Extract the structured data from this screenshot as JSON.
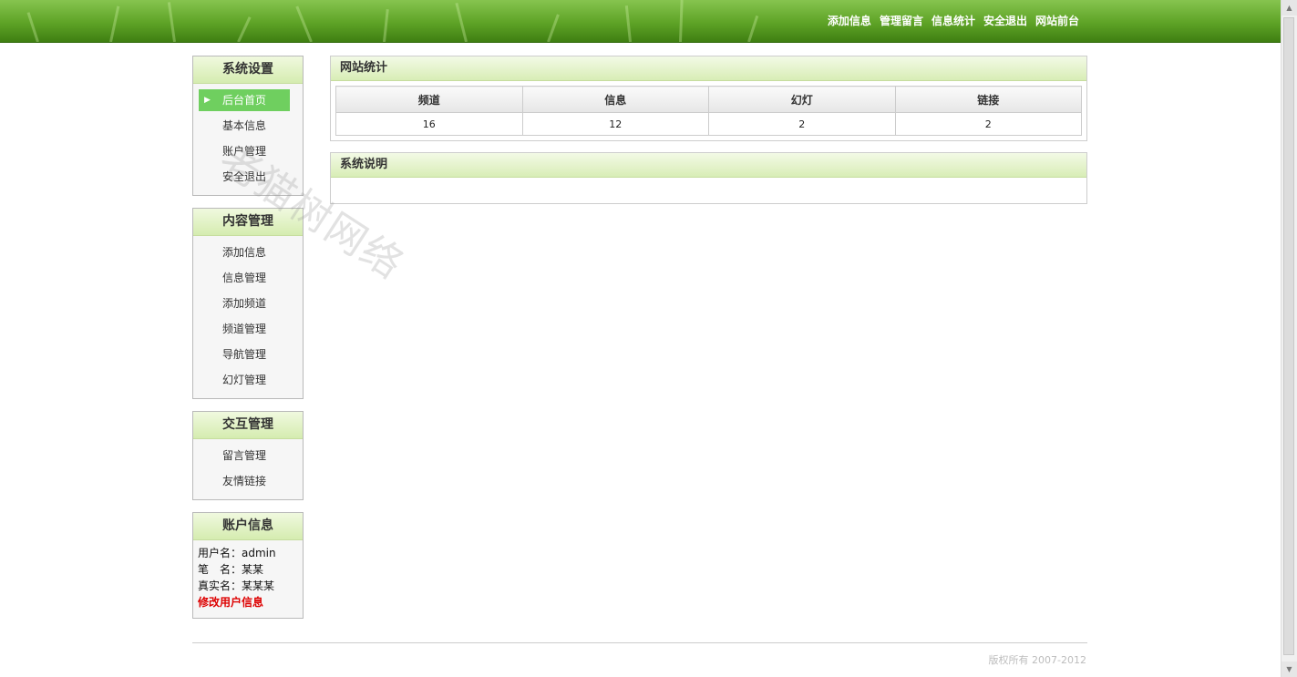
{
  "header": {
    "nav": [
      "添加信息",
      "管理留言",
      "信息统计",
      "安全退出",
      "网站前台"
    ]
  },
  "sidebar": {
    "system": {
      "title": "系统设置",
      "items": [
        "后台首页",
        "基本信息",
        "账户管理",
        "安全退出"
      ]
    },
    "content": {
      "title": "内容管理",
      "items": [
        "添加信息",
        "信息管理",
        "添加频道",
        "频道管理",
        "导航管理",
        "幻灯管理"
      ]
    },
    "interaction": {
      "title": "交互管理",
      "items": [
        "留言管理",
        "友情链接"
      ]
    },
    "account": {
      "title": "账户信息",
      "username_label": "用户名：",
      "username": "admin",
      "penname_label": "笔　名：",
      "penname": "某某",
      "realname_label": "真实名：",
      "realname": "某某某",
      "edit_link": "修改用户信息"
    }
  },
  "main": {
    "stats": {
      "title": "网站统计",
      "headers": [
        "频道",
        "信息",
        "幻灯",
        "链接"
      ],
      "values": [
        "16",
        "12",
        "2",
        "2"
      ]
    },
    "description": {
      "title": "系统说明"
    }
  },
  "watermark": "老猫树网络",
  "footer": {
    "copyright": "版权所有  2007-2012"
  },
  "colors": {
    "header_green": "#5ea326",
    "active_menu": "#6fcf5f",
    "panel_title": "#d8edb6",
    "edit_link": "#dd0000"
  }
}
